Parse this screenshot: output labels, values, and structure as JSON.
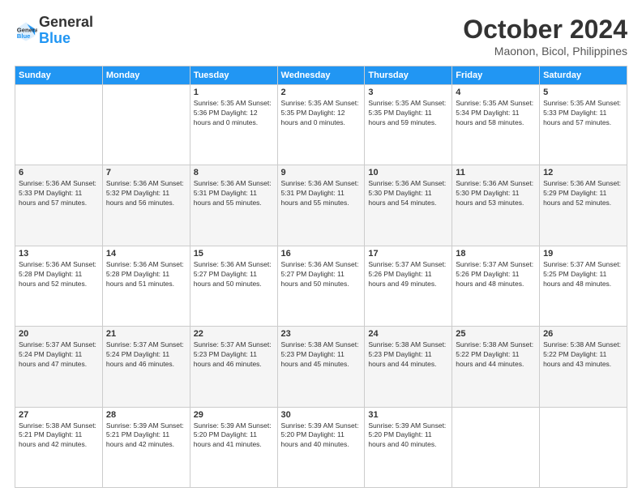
{
  "logo": {
    "line1": "General",
    "line2": "Blue"
  },
  "title": "October 2024",
  "location": "Maonon, Bicol, Philippines",
  "weekdays": [
    "Sunday",
    "Monday",
    "Tuesday",
    "Wednesday",
    "Thursday",
    "Friday",
    "Saturday"
  ],
  "weeks": [
    [
      {
        "day": "",
        "info": ""
      },
      {
        "day": "",
        "info": ""
      },
      {
        "day": "1",
        "info": "Sunrise: 5:35 AM\nSunset: 5:36 PM\nDaylight: 12 hours\nand 0 minutes."
      },
      {
        "day": "2",
        "info": "Sunrise: 5:35 AM\nSunset: 5:35 PM\nDaylight: 12 hours\nand 0 minutes."
      },
      {
        "day": "3",
        "info": "Sunrise: 5:35 AM\nSunset: 5:35 PM\nDaylight: 11 hours\nand 59 minutes."
      },
      {
        "day": "4",
        "info": "Sunrise: 5:35 AM\nSunset: 5:34 PM\nDaylight: 11 hours\nand 58 minutes."
      },
      {
        "day": "5",
        "info": "Sunrise: 5:35 AM\nSunset: 5:33 PM\nDaylight: 11 hours\nand 57 minutes."
      }
    ],
    [
      {
        "day": "6",
        "info": "Sunrise: 5:36 AM\nSunset: 5:33 PM\nDaylight: 11 hours\nand 57 minutes."
      },
      {
        "day": "7",
        "info": "Sunrise: 5:36 AM\nSunset: 5:32 PM\nDaylight: 11 hours\nand 56 minutes."
      },
      {
        "day": "8",
        "info": "Sunrise: 5:36 AM\nSunset: 5:31 PM\nDaylight: 11 hours\nand 55 minutes."
      },
      {
        "day": "9",
        "info": "Sunrise: 5:36 AM\nSunset: 5:31 PM\nDaylight: 11 hours\nand 55 minutes."
      },
      {
        "day": "10",
        "info": "Sunrise: 5:36 AM\nSunset: 5:30 PM\nDaylight: 11 hours\nand 54 minutes."
      },
      {
        "day": "11",
        "info": "Sunrise: 5:36 AM\nSunset: 5:30 PM\nDaylight: 11 hours\nand 53 minutes."
      },
      {
        "day": "12",
        "info": "Sunrise: 5:36 AM\nSunset: 5:29 PM\nDaylight: 11 hours\nand 52 minutes."
      }
    ],
    [
      {
        "day": "13",
        "info": "Sunrise: 5:36 AM\nSunset: 5:28 PM\nDaylight: 11 hours\nand 52 minutes."
      },
      {
        "day": "14",
        "info": "Sunrise: 5:36 AM\nSunset: 5:28 PM\nDaylight: 11 hours\nand 51 minutes."
      },
      {
        "day": "15",
        "info": "Sunrise: 5:36 AM\nSunset: 5:27 PM\nDaylight: 11 hours\nand 50 minutes."
      },
      {
        "day": "16",
        "info": "Sunrise: 5:36 AM\nSunset: 5:27 PM\nDaylight: 11 hours\nand 50 minutes."
      },
      {
        "day": "17",
        "info": "Sunrise: 5:37 AM\nSunset: 5:26 PM\nDaylight: 11 hours\nand 49 minutes."
      },
      {
        "day": "18",
        "info": "Sunrise: 5:37 AM\nSunset: 5:26 PM\nDaylight: 11 hours\nand 48 minutes."
      },
      {
        "day": "19",
        "info": "Sunrise: 5:37 AM\nSunset: 5:25 PM\nDaylight: 11 hours\nand 48 minutes."
      }
    ],
    [
      {
        "day": "20",
        "info": "Sunrise: 5:37 AM\nSunset: 5:24 PM\nDaylight: 11 hours\nand 47 minutes."
      },
      {
        "day": "21",
        "info": "Sunrise: 5:37 AM\nSunset: 5:24 PM\nDaylight: 11 hours\nand 46 minutes."
      },
      {
        "day": "22",
        "info": "Sunrise: 5:37 AM\nSunset: 5:23 PM\nDaylight: 11 hours\nand 46 minutes."
      },
      {
        "day": "23",
        "info": "Sunrise: 5:38 AM\nSunset: 5:23 PM\nDaylight: 11 hours\nand 45 minutes."
      },
      {
        "day": "24",
        "info": "Sunrise: 5:38 AM\nSunset: 5:23 PM\nDaylight: 11 hours\nand 44 minutes."
      },
      {
        "day": "25",
        "info": "Sunrise: 5:38 AM\nSunset: 5:22 PM\nDaylight: 11 hours\nand 44 minutes."
      },
      {
        "day": "26",
        "info": "Sunrise: 5:38 AM\nSunset: 5:22 PM\nDaylight: 11 hours\nand 43 minutes."
      }
    ],
    [
      {
        "day": "27",
        "info": "Sunrise: 5:38 AM\nSunset: 5:21 PM\nDaylight: 11 hours\nand 42 minutes."
      },
      {
        "day": "28",
        "info": "Sunrise: 5:39 AM\nSunset: 5:21 PM\nDaylight: 11 hours\nand 42 minutes."
      },
      {
        "day": "29",
        "info": "Sunrise: 5:39 AM\nSunset: 5:20 PM\nDaylight: 11 hours\nand 41 minutes."
      },
      {
        "day": "30",
        "info": "Sunrise: 5:39 AM\nSunset: 5:20 PM\nDaylight: 11 hours\nand 40 minutes."
      },
      {
        "day": "31",
        "info": "Sunrise: 5:39 AM\nSunset: 5:20 PM\nDaylight: 11 hours\nand 40 minutes."
      },
      {
        "day": "",
        "info": ""
      },
      {
        "day": "",
        "info": ""
      }
    ]
  ]
}
